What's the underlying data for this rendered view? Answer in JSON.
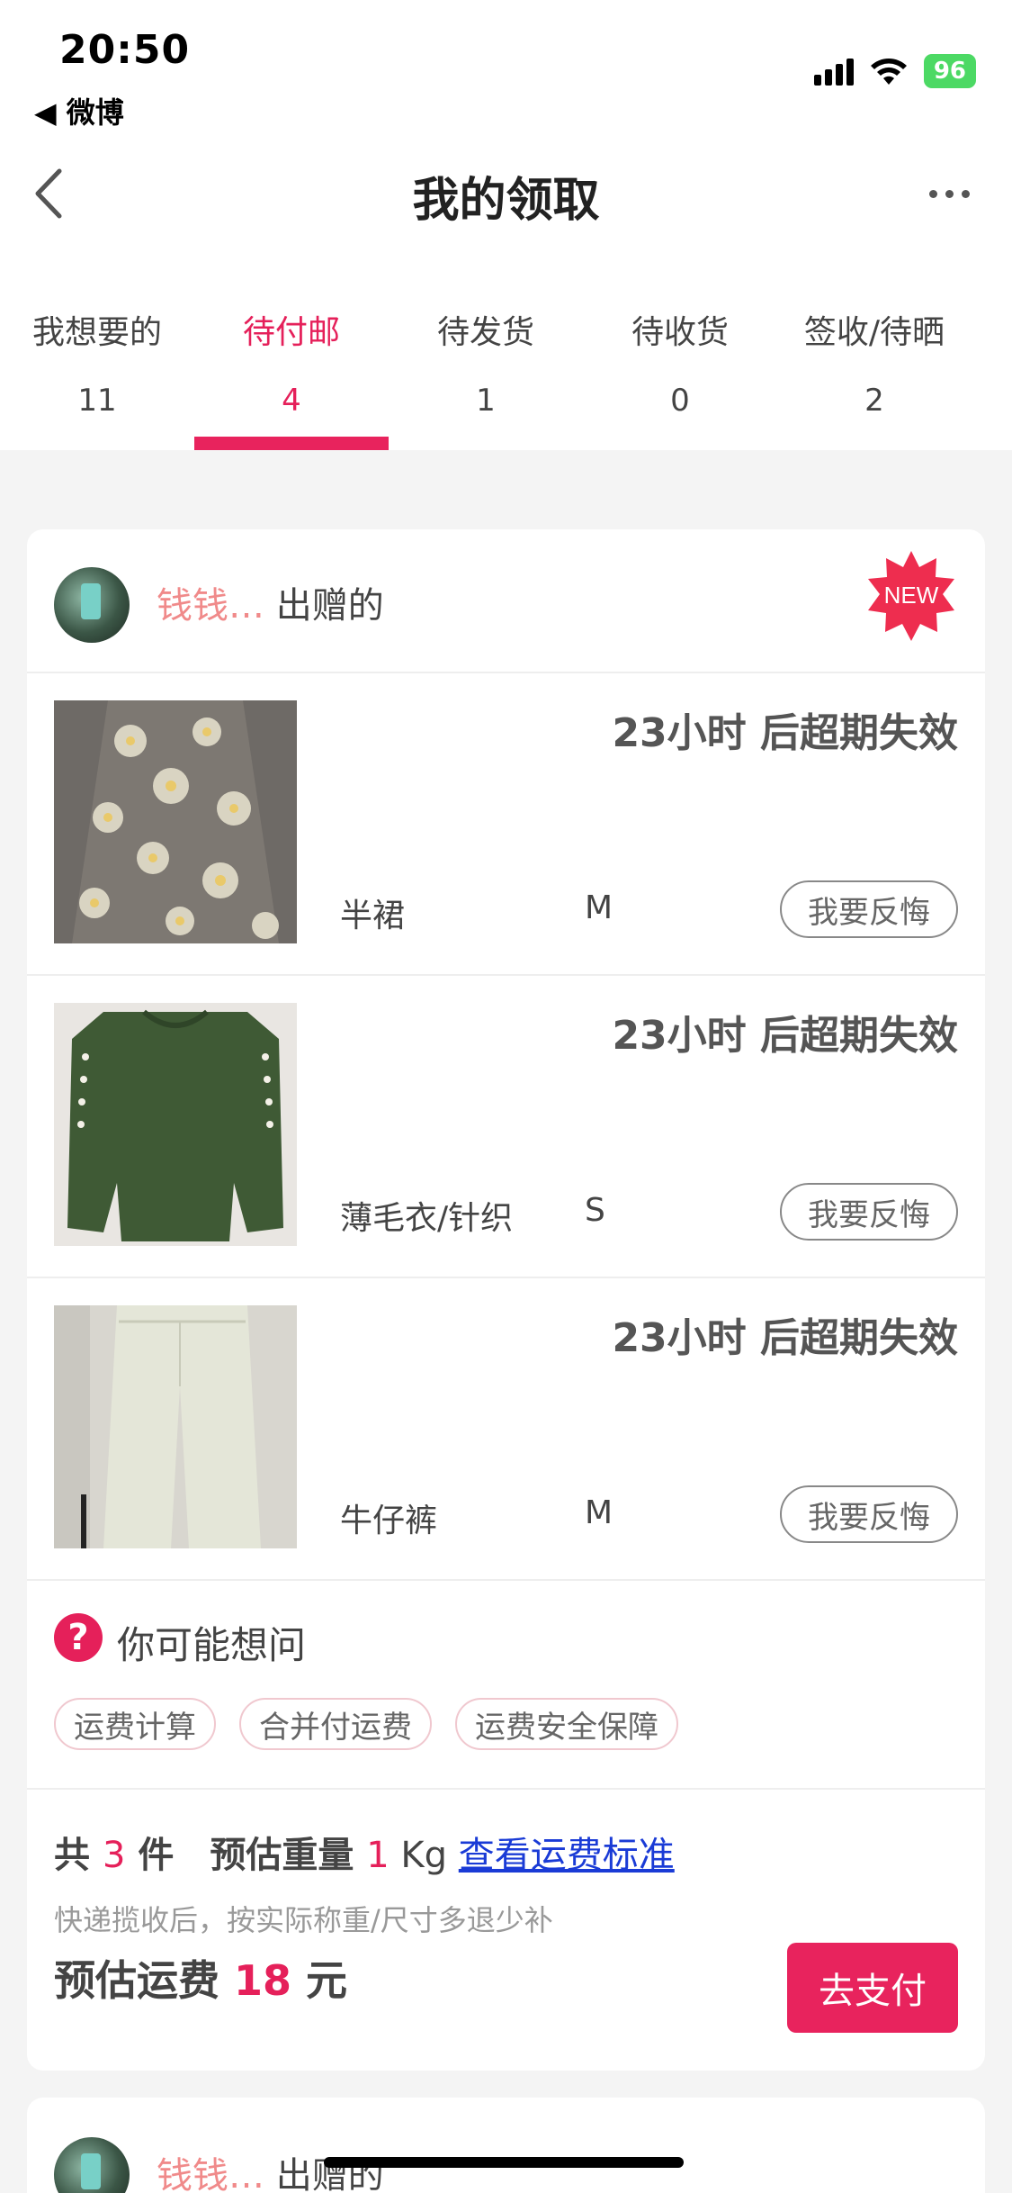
{
  "status_bar": {
    "time": "20:50",
    "back_app": "◀ 微博",
    "battery": "96"
  },
  "nav": {
    "title": "我的领取"
  },
  "tabs": [
    {
      "label": "我想要的",
      "count": "11",
      "active": false
    },
    {
      "label": "待付邮",
      "count": "4",
      "active": true
    },
    {
      "label": "待发货",
      "count": "1",
      "active": false
    },
    {
      "label": "待收货",
      "count": "0",
      "active": false
    },
    {
      "label": "签收/待晒",
      "count": "2",
      "active": false
    }
  ],
  "order": {
    "giver_name": "钱钱…",
    "giver_suffix": " 出赠的",
    "new_badge": "NEW",
    "items": [
      {
        "countdown": "23小时 后超期失效",
        "name": "半裙",
        "size": "M",
        "regret_label": "我要反悔"
      },
      {
        "countdown": "23小时 后超期失效",
        "name": "薄毛衣/针织",
        "size": "S",
        "regret_label": "我要反悔"
      },
      {
        "countdown": "23小时 后超期失效",
        "name": "牛仔裤",
        "size": "M",
        "regret_label": "我要反悔"
      }
    ],
    "faq": {
      "icon": "?",
      "title": "你可能想问",
      "tags": [
        "运费计算",
        "合并付运费",
        "运费安全保障"
      ]
    },
    "summary": {
      "total_prefix": "共 ",
      "total_count": "3",
      "total_suffix": " 件　预估重量 ",
      "weight": "1",
      "weight_unit": " Kg ",
      "fee_standard_link": "查看运费标准",
      "note": "快递揽收后，按实际称重/尺寸多退少补",
      "fee_prefix": "预估运费 ",
      "fee_value": "18",
      "fee_suffix": " 元",
      "pay_label": "去支付"
    }
  },
  "order2": {
    "giver_name": "钱钱…",
    "giver_suffix": " 出赠的"
  },
  "colors": {
    "accent": "#e8235d",
    "link": "#1a3bd6"
  }
}
